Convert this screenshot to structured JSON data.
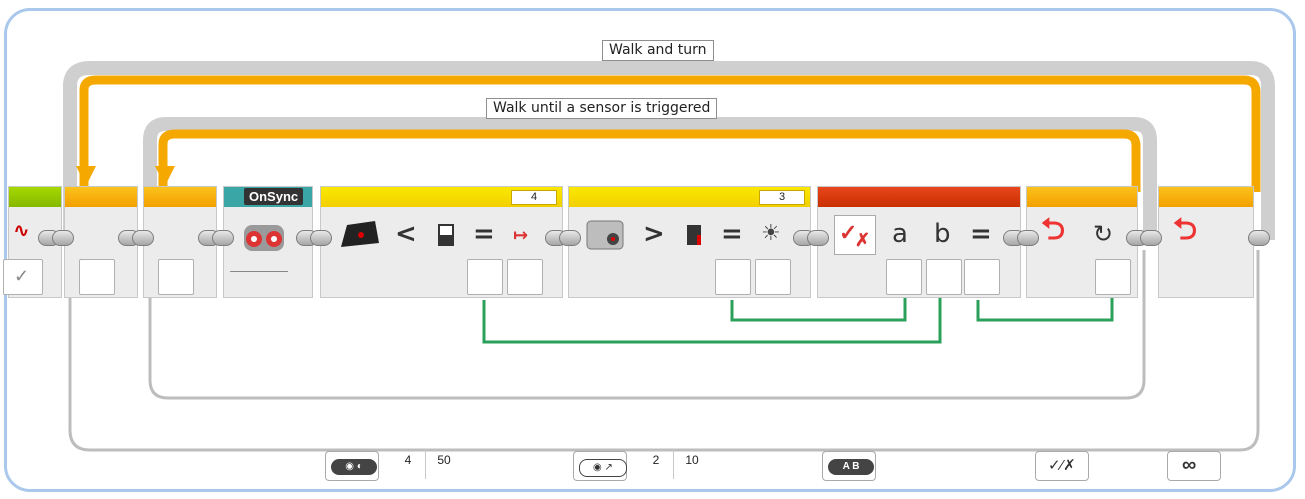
{
  "loops": {
    "outer_label": "Walk and turn",
    "inner_label": "Walk until a sensor is triggered"
  },
  "blocks": {
    "sync": {
      "label": "OnSync"
    },
    "ir_compare": {
      "port": "4",
      "operator": "<",
      "eq": "=",
      "param1": "4",
      "param2": "50"
    },
    "color_compare": {
      "port": "3",
      "operator": ">",
      "eq": "=",
      "param1": "2",
      "param2": "10"
    },
    "logic": {
      "a": "a",
      "b": "b",
      "eq": "=",
      "mode_label": "A B"
    },
    "loop_interrupt_check": {
      "symbol": "✓⁄✗"
    },
    "loop_end": {
      "symbol": "∞"
    }
  },
  "colors": {
    "frame": "#a9c8ec",
    "loop_wire": "#f5a800",
    "data_wire": "#2aa05a",
    "seq_wire": "#b8b8b8"
  }
}
